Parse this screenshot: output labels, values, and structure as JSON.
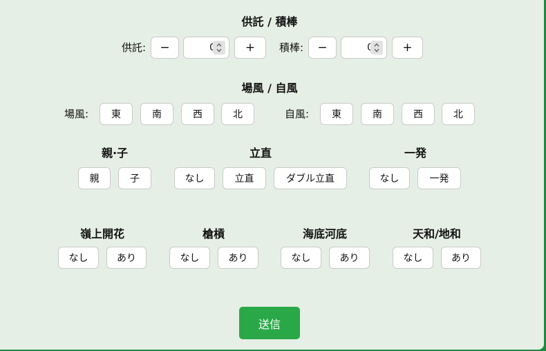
{
  "deposit": {
    "title": "供託 / 積棒",
    "kyotaku_label": "供託:",
    "kyotaku_value": "0",
    "tsumibo_label": "積棒:",
    "tsumibo_value": "0",
    "minus": "−",
    "plus": "+"
  },
  "wind": {
    "title": "場風 / 自風",
    "bakaze_label": "場風:",
    "jikaze_label": "自風:",
    "options": [
      "東",
      "南",
      "西",
      "北"
    ]
  },
  "oya_ko": {
    "title": "親·子",
    "options": [
      "親",
      "子"
    ]
  },
  "riichi": {
    "title": "立直",
    "options": [
      "なし",
      "立直",
      "ダブル立直"
    ]
  },
  "ippatsu": {
    "title": "一発",
    "options": [
      "なし",
      "一発"
    ]
  },
  "rinshan": {
    "title": "嶺上開花",
    "options": [
      "なし",
      "あり"
    ]
  },
  "chankan": {
    "title": "槍槓",
    "options": [
      "なし",
      "あり"
    ]
  },
  "haitei": {
    "title": "海底河底",
    "options": [
      "なし",
      "あり"
    ]
  },
  "tenhou": {
    "title": "天和/地和",
    "options": [
      "なし",
      "あり"
    ]
  },
  "submit_label": "送信",
  "colors": {
    "background": "#e6efe6",
    "accent": "#2aa847"
  }
}
